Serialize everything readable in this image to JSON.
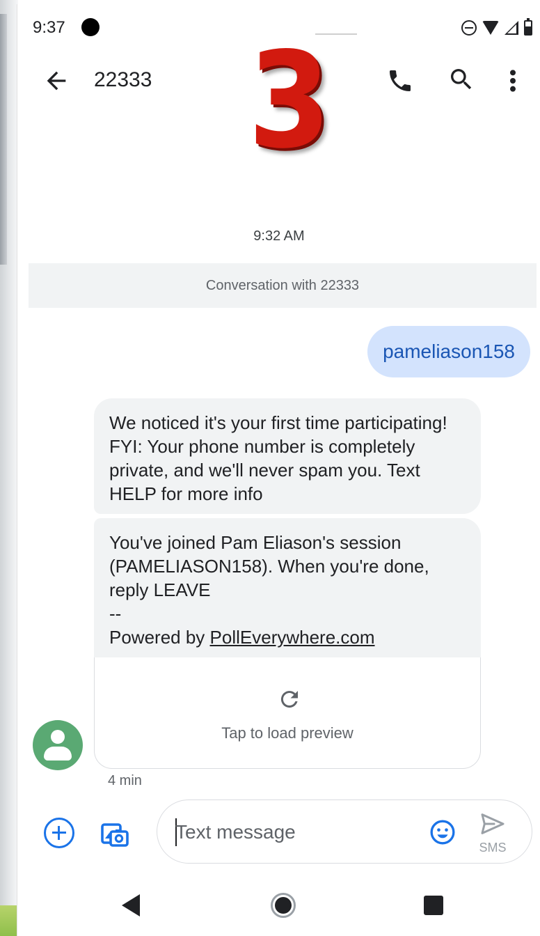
{
  "status_bar": {
    "time": "9:37"
  },
  "app_bar": {
    "title": "22333"
  },
  "overlay": {
    "number": "3"
  },
  "conversation": {
    "timestamp": "9:32 AM",
    "banner": "Conversation with 22333",
    "outgoing": {
      "text": "pameliason158"
    },
    "incoming": [
      {
        "text": "We noticed it's your first time participating! FYI: Your phone number is completely private, and we'll never spam you. Text HELP for more info"
      },
      {
        "line1": "You've joined Pam Eliason's session (PAMELIASON158). When you're done, reply LEAVE",
        "separator": "--",
        "powered_prefix": "Powered by ",
        "powered_link": "PollEverywhere.com",
        "preview_label": "Tap to load preview"
      }
    ],
    "meta": "4 min"
  },
  "compose": {
    "placeholder": "Text message",
    "send_label": "SMS"
  },
  "colors": {
    "accent": "#1a73e8",
    "outgoing_bubble": "#d3e3fd",
    "incoming_bubble": "#f1f3f4",
    "avatar": "#5aa973",
    "overlay_red": "#d21a0f"
  }
}
